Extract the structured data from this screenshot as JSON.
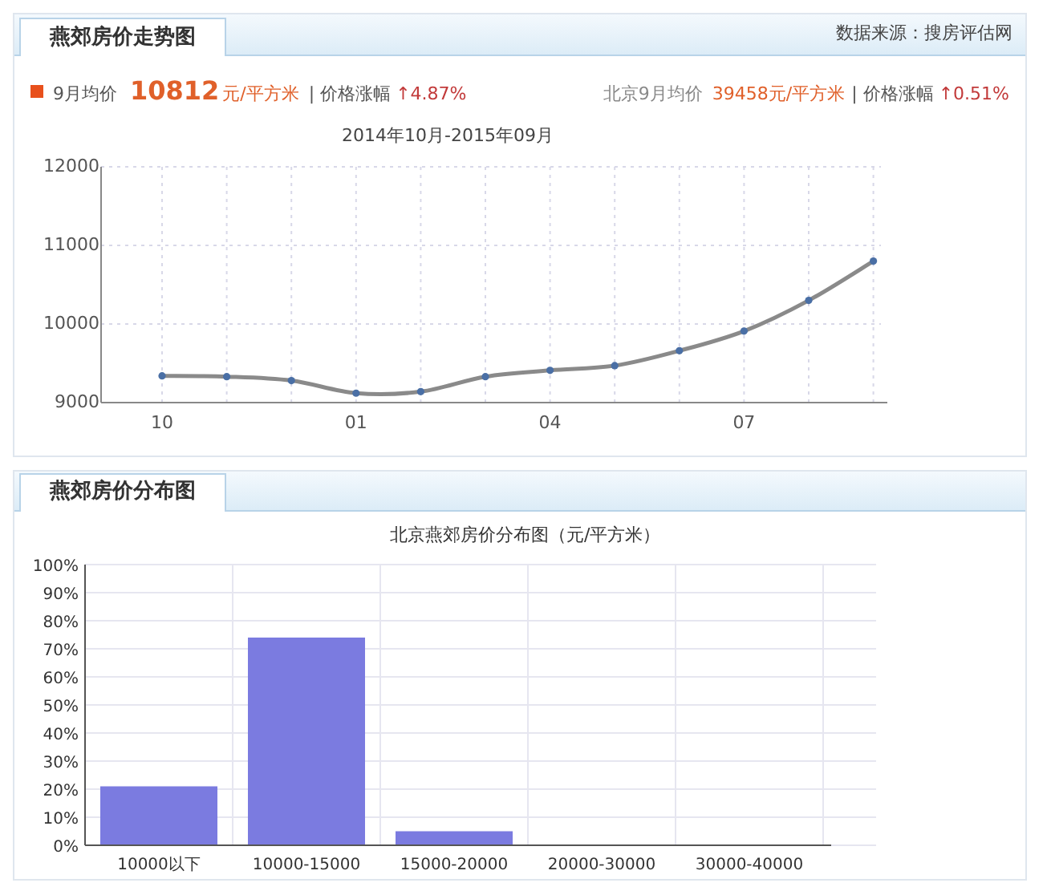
{
  "trend_panel": {
    "tab": "燕郊房价走势图",
    "source": "数据来源：搜房评估网",
    "summary": {
      "label": "9月均价",
      "price": "10812",
      "unit": "元/平方米",
      "change_label": "| 价格涨幅",
      "change": "↑4.87%"
    },
    "beijing": {
      "label": "北京9月均价",
      "price": "39458元/平方米",
      "change_label": "| 价格涨幅",
      "change": "↑0.51%"
    },
    "chart_data": {
      "type": "line",
      "title": "2014年10月-2015年09月",
      "grid": true,
      "categories": [
        "10",
        null,
        null,
        "01",
        null,
        null,
        "04",
        null,
        null,
        "07",
        null,
        null
      ],
      "ylim": [
        9000,
        12000
      ],
      "yticks": [
        9000,
        10000,
        11000,
        12000
      ],
      "series": [
        {
          "color": "#4a6fa5",
          "marker": true,
          "values": [
            9340,
            9330,
            9280,
            9120,
            9140,
            9330,
            9410,
            9470,
            9660,
            9910,
            10300,
            10800
          ]
        }
      ]
    }
  },
  "distribution_panel": {
    "tab": "燕郊房价分布图",
    "chart_data": {
      "type": "bar",
      "title": "北京燕郊房价分布图（元/平方米）",
      "grid": true,
      "categories": [
        "10000以下",
        "10000-15000",
        "15000-20000",
        "20000-30000",
        "30000-40000"
      ],
      "ylim": [
        0,
        100
      ],
      "yticks": [
        {
          "value": 0,
          "label": "0%"
        },
        {
          "value": 10,
          "label": "10%"
        },
        {
          "value": 20,
          "label": "20%"
        },
        {
          "value": 30,
          "label": "30%"
        },
        {
          "value": 40,
          "label": "40%"
        },
        {
          "value": 50,
          "label": "50%"
        },
        {
          "value": 60,
          "label": "60%"
        },
        {
          "value": 70,
          "label": "70%"
        },
        {
          "value": 80,
          "label": "80%"
        },
        {
          "value": 90,
          "label": "90%"
        },
        {
          "value": 100,
          "label": "100%"
        }
      ],
      "series": [
        {
          "color": "#7b7be0",
          "values": [
            21,
            74,
            5,
            0,
            0
          ]
        }
      ]
    }
  }
}
